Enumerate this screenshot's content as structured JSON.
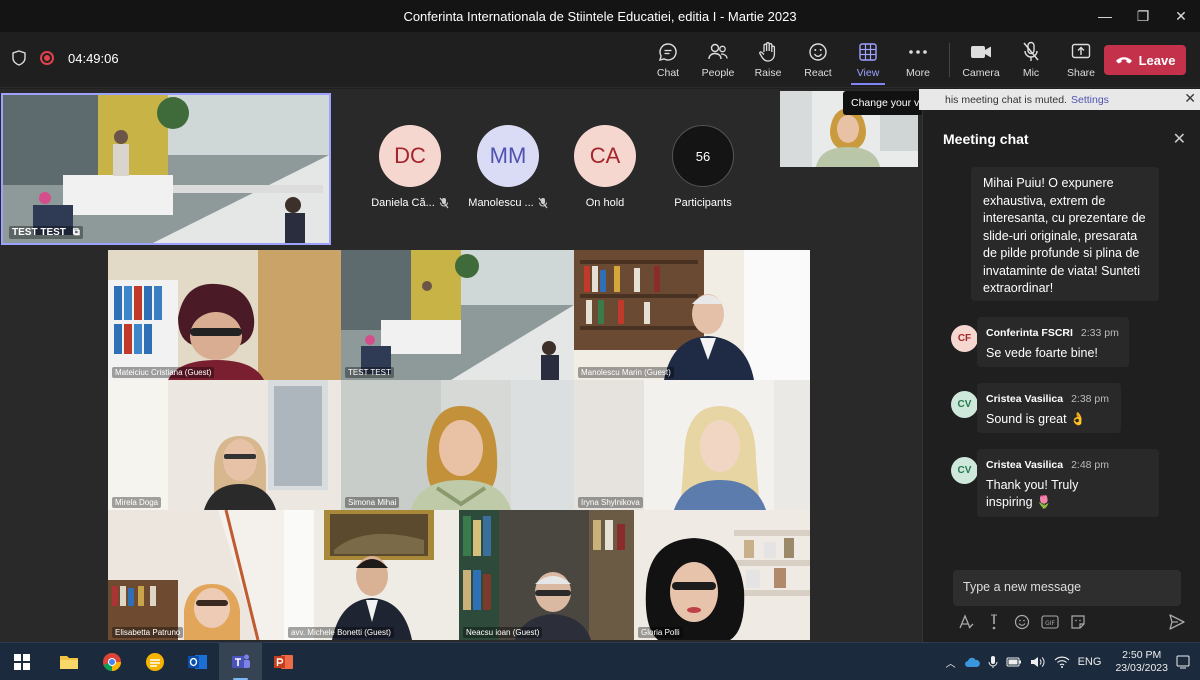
{
  "window": {
    "title": "Conferinta Internationala de Stiintele Educatiei, editia I - Martie 2023",
    "minimize": "—",
    "restore": "❐",
    "close": "✕"
  },
  "toolbar": {
    "timer": "04:49:06",
    "buttons": [
      {
        "label": "Chat",
        "icon": "chat-icon"
      },
      {
        "label": "People",
        "icon": "people-icon"
      },
      {
        "label": "Raise",
        "icon": "raise-hand-icon"
      },
      {
        "label": "React",
        "icon": "react-icon"
      },
      {
        "label": "View",
        "icon": "view-icon"
      },
      {
        "label": "More",
        "icon": "more-icon"
      },
      {
        "label": "Camera",
        "icon": "camera-icon"
      },
      {
        "label": "Mic",
        "icon": "mic-icon"
      },
      {
        "label": "Share",
        "icon": "share-icon"
      }
    ],
    "leave_label": "Leave",
    "tooltip": "Change your view"
  },
  "stage": {
    "self_name": "TEST TEST",
    "avatars": [
      {
        "initials": "DC",
        "name": "Daniela Că...",
        "bg": "#f6d7d0",
        "fg": "#a4262c"
      },
      {
        "initials": "MM",
        "name": "Manolescu ...",
        "bg": "#d9dcf4",
        "fg": "#4f52b2"
      },
      {
        "initials": "CA",
        "name": "On hold",
        "bg": "#f6d7d0",
        "fg": "#a4262c"
      }
    ],
    "participants_count": "56",
    "participants_label": "Participants",
    "grid_names": [
      "Mateiciuc Cristiana (Guest)",
      "TEST TEST",
      "Manolescu Marin (Guest)",
      "Mirela Doga",
      "Simona Mihai",
      "Iryna Shylnikova",
      "Elisabetta Patruno",
      "avv. Michele Bonetti (Guest)",
      "Neacsu ioan (Guest)",
      "Gloria Polli"
    ]
  },
  "chat": {
    "banner_text": "his meeting chat is muted.",
    "banner_link": "Settings",
    "title": "Meeting chat",
    "first_message": "Mihai Puiu! O expunere exhaustiva, extrem de interesanta, cu prezentare de slide-uri originale, presarata de pilde profunde  si plina de invataminte de viata! Sunteti extraordinar!",
    "messages": [
      {
        "initials": "CF",
        "name": "Conferinta FSCRI",
        "time": "2:33 pm",
        "text": "Se vede foarte bine!",
        "bg": "#f6d7d0",
        "fg": "#a4262c"
      },
      {
        "initials": "CV",
        "name": "Cristea Vasilica",
        "time": "2:38 pm",
        "text": "Sound is great 👌",
        "bg": "#cfe8dc",
        "fg": "#237b4b"
      },
      {
        "initials": "CV",
        "name": "Cristea Vasilica",
        "time": "2:48 pm",
        "text": "Thank you! Truly inspiring 🌷",
        "bg": "#cfe8dc",
        "fg": "#237b4b"
      }
    ],
    "compose_placeholder": "Type a new message"
  },
  "taskbar": {
    "lang": "ENG",
    "time": "2:50 PM",
    "date": "23/03/2023"
  }
}
